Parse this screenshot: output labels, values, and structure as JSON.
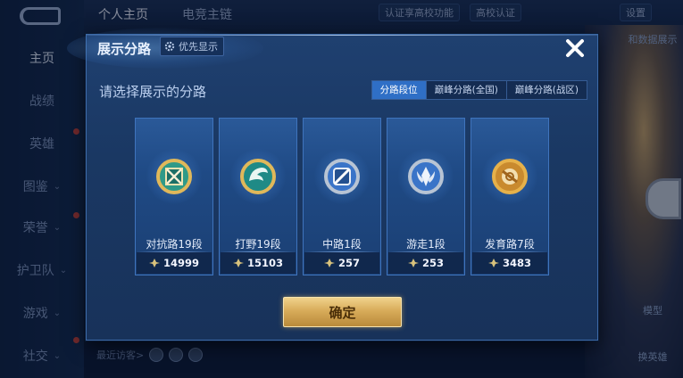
{
  "background": {
    "nav": {
      "items": [
        {
          "label": "主页",
          "has_chevron": false
        },
        {
          "label": "战绩",
          "has_chevron": false
        },
        {
          "label": "英雄",
          "has_chevron": false
        },
        {
          "label": "图鉴",
          "has_chevron": true
        },
        {
          "label": "荣誉",
          "has_chevron": true
        },
        {
          "label": "护卫队",
          "has_chevron": true
        },
        {
          "label": "游戏",
          "has_chevron": true
        },
        {
          "label": "社交",
          "has_chevron": true
        }
      ],
      "chevron": "⌄"
    },
    "top_tabs": {
      "profile": "个人主页",
      "esports": "电竞主链"
    },
    "top_chips": {
      "campus": "认证享高校功能",
      "campus_badge": "高校认证",
      "settings": "设置"
    },
    "side_buttons": {
      "skin": "和数据展示",
      "model": "模型",
      "switch_hero": "换英雄"
    },
    "visitors_label": "最近访客>"
  },
  "dialog": {
    "title": "展示分路",
    "priority_button": "优先显示",
    "subtitle": "请选择展示的分路",
    "tabs": [
      {
        "label": "分路段位",
        "active": true
      },
      {
        "label": "巅峰分路(全国)",
        "active": false
      },
      {
        "label": "巅峰分路(战区)",
        "active": false
      }
    ],
    "lanes": [
      {
        "name": "对抗路19段",
        "score": "14999",
        "emblem": "clash-lane-emblem-icon",
        "rim": "#e0b85a",
        "core": "#2f9a88"
      },
      {
        "name": "打野19段",
        "score": "15103",
        "emblem": "jungle-emblem-icon",
        "rim": "#e0b85a",
        "core": "#1f8a86"
      },
      {
        "name": "中路1段",
        "score": "257",
        "emblem": "mid-lane-emblem-icon",
        "rim": "#b8c4d4",
        "core": "#3a74c8"
      },
      {
        "name": "游走1段",
        "score": "253",
        "emblem": "roam-emblem-icon",
        "rim": "#b8c4d4",
        "core": "#3a74c8"
      },
      {
        "name": "发育路7段",
        "score": "3483",
        "emblem": "farm-lane-emblem-icon",
        "rim": "#e6b14a",
        "core": "#c98a2e"
      }
    ],
    "confirm": "确定",
    "close_icon": "close-icon"
  }
}
